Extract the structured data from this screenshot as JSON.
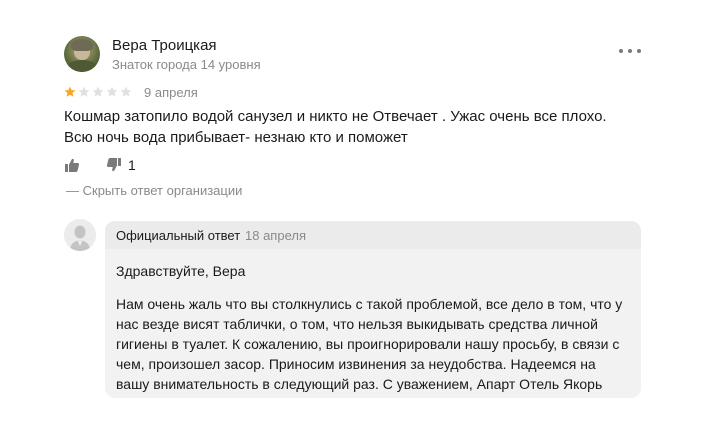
{
  "review": {
    "author_name": "Вера Троицкая",
    "author_level": "Знаток города 14 уровня",
    "rating": 1,
    "rating_max": 5,
    "date": "9 апреля",
    "text": "Кошмар затопило водой санузел и никто не Отвечает . Ужас очень все плохо. Всю ночь вода прибывает- незнаю кто и поможет",
    "dislike_count": "1",
    "hide_reply_label": "— Скрыть ответ организации"
  },
  "reply": {
    "label": "Официальный ответ",
    "date": "18 апреля",
    "greeting": "Здравствуйте, Вера",
    "body": "Нам очень жаль что вы столкнулись с такой проблемой, все дело в том, что у нас везде висят таблички, о том, что нельзя выкидывать средства личной гигиены в туалет. К сожалению, вы проигнорировали нашу просьбу, в связи с чем, произошел засор. Приносим извинения за неудобства. Надеемся на вашу внимательность в следующий раз. С уважением, Апарт Отель Якорь"
  },
  "icons": {
    "more": "more-dots-icon",
    "like": "thumbs-up-icon",
    "dislike": "thumbs-down-icon",
    "org_avatar": "organization-avatar-icon",
    "star": "star-icon"
  },
  "colors": {
    "star_filled": "#f5a623",
    "star_empty": "#e0e0e0",
    "muted_text": "#8a8a8a",
    "reply_background": "#f2f2f2"
  }
}
